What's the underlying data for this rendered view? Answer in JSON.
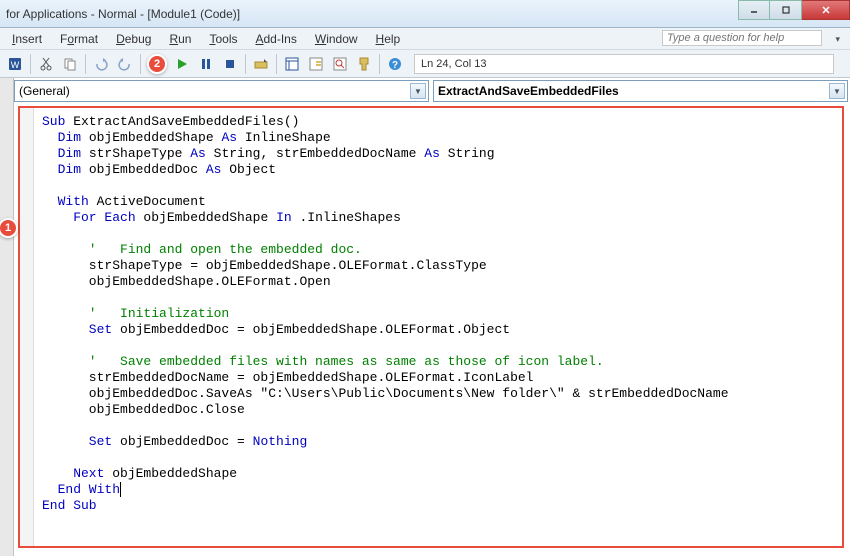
{
  "window": {
    "title": "for Applications - Normal - [Module1 (Code)]"
  },
  "menus": {
    "insert": "Insert",
    "format": "Format",
    "debug": "Debug",
    "run": "Run",
    "tools": "Tools",
    "addins": "Add-Ins",
    "window": "Window",
    "help": "Help"
  },
  "helpbox": {
    "placeholder": "Type a question for help"
  },
  "toolbar": {
    "status": "Ln 24, Col 13"
  },
  "dropdowns": {
    "left": "(General)",
    "right": "ExtractAndSaveEmbeddedFiles"
  },
  "callouts": {
    "one": "1",
    "two": "2"
  },
  "code": {
    "l1a": "Sub",
    "l1b": " ExtractAndSaveEmbeddedFiles()",
    "l2a": "  Dim",
    "l2b": " objEmbeddedShape ",
    "l2c": "As",
    "l2d": " InlineShape",
    "l3a": "  Dim",
    "l3b": " strShapeType ",
    "l3c": "As",
    "l3d": " String, strEmbeddedDocName ",
    "l3e": "As",
    "l3f": " String",
    "l4a": "  Dim",
    "l4b": " objEmbeddedDoc ",
    "l4c": "As",
    "l4d": " Object",
    "l6a": "  With",
    "l6b": " ActiveDocument",
    "l7a": "    For Each",
    "l7b": " objEmbeddedShape ",
    "l7c": "In",
    "l7d": " .InlineShapes",
    "l9a": "      '   Find and open the embedded doc.",
    "l10": "      strShapeType = objEmbeddedShape.OLEFormat.ClassType",
    "l11": "      objEmbeddedShape.OLEFormat.Open",
    "l13a": "      '   Initialization",
    "l14a": "      Set",
    "l14b": " objEmbeddedDoc = objEmbeddedShape.OLEFormat.Object",
    "l16a": "      '   Save embedded files with names as same as those of icon label.",
    "l17": "      strEmbeddedDocName = objEmbeddedShape.OLEFormat.IconLabel",
    "l18": "      objEmbeddedDoc.SaveAs \"C:\\Users\\Public\\Documents\\New folder\\\" & strEmbeddedDocName",
    "l19": "      objEmbeddedDoc.Close",
    "l21a": "      Set",
    "l21b": " objEmbeddedDoc = ",
    "l21c": "Nothing",
    "l23a": "    Next",
    "l23b": " objEmbeddedShape",
    "l24a": "  End With",
    "l25a": "End Sub"
  }
}
